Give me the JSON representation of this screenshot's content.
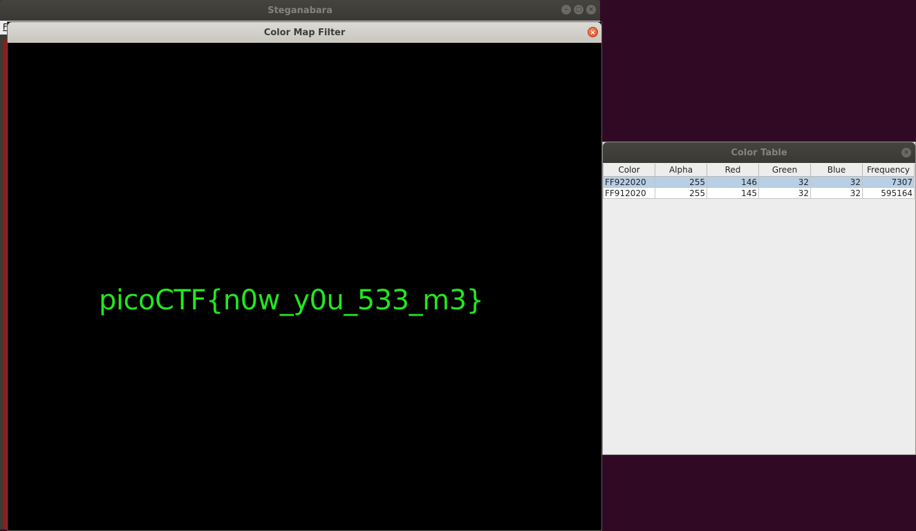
{
  "main_window": {
    "title": "Steganabara",
    "menu_first_letter": "F",
    "controls": {
      "minimize": "–",
      "maximize": "□",
      "close": "×"
    }
  },
  "color_map_filter": {
    "title": "Color Map Filter",
    "close_glyph": "×",
    "revealed_text": "picoCTF{n0w_y0u_533_m3}",
    "text_color": "#22e81e"
  },
  "color_table": {
    "title": "Color Table",
    "close_glyph": "×",
    "columns": [
      "Color",
      "Alpha",
      "Red",
      "Green",
      "Blue",
      "Frequency"
    ],
    "rows": [
      {
        "color": "FF922020",
        "alpha": "255",
        "red": "146",
        "green": "32",
        "blue": "32",
        "frequency": "7307",
        "selected": true
      },
      {
        "color": "FF912020",
        "alpha": "255",
        "red": "145",
        "green": "32",
        "blue": "32",
        "frequency": "595164",
        "selected": false
      }
    ]
  },
  "desktop_background": "#300a24"
}
